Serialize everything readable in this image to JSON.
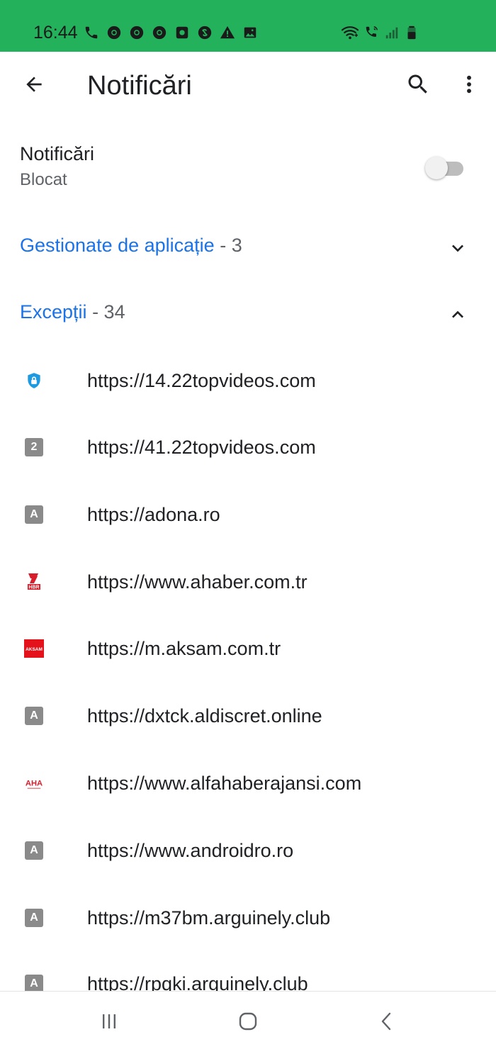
{
  "status_bar": {
    "time": "16:44",
    "background": "#23b25b",
    "left_icons": [
      "phone-icon",
      "chrome-icon",
      "chrome-icon",
      "chrome-icon",
      "screen-recorder-icon",
      "shazam-icon",
      "warning-icon",
      "image-icon"
    ],
    "right_icons": [
      "wifi-icon",
      "wifi-call-icon",
      "signal-icon",
      "battery-icon"
    ]
  },
  "app_bar": {
    "title": "Notificări",
    "back_icon": "arrow-back-icon",
    "search_icon": "search-icon",
    "more_icon": "more-vert-icon"
  },
  "notifications_setting": {
    "title": "Notificări",
    "subtitle": "Blocat",
    "enabled": false
  },
  "sections": {
    "managed": {
      "label": "Gestionate de aplicație",
      "count": "- 3",
      "expanded": false
    },
    "exceptions": {
      "label": "Excepții",
      "count": "- 34",
      "expanded": true
    }
  },
  "accent_color": "#1a73e8",
  "sites": [
    {
      "url": "https://14.22topvideos.com",
      "icon": "shield-lock-icon"
    },
    {
      "url": "https://41.22topvideos.com",
      "icon": "letter-badge",
      "letter": "2"
    },
    {
      "url": "https://adona.ro",
      "icon": "letter-badge",
      "letter": "A"
    },
    {
      "url": "https://www.ahaber.com.tr",
      "icon": "ahaber-favicon",
      "brand_text": "HBR"
    },
    {
      "url": "https://m.aksam.com.tr",
      "icon": "aksam-favicon",
      "brand_text": "AKSAM"
    },
    {
      "url": "https://dxtck.aldiscret.online",
      "icon": "letter-badge",
      "letter": "A"
    },
    {
      "url": "https://www.alfahaberajansi.com",
      "icon": "aha-favicon",
      "brand_text": "AHA"
    },
    {
      "url": "https://www.androidro.ro",
      "icon": "letter-badge",
      "letter": "A"
    },
    {
      "url": "https://m37bm.arguinely.club",
      "icon": "letter-badge",
      "letter": "A"
    },
    {
      "url": "https://rpqki.arguinely.club",
      "icon": "letter-badge",
      "letter": "A"
    }
  ],
  "nav_bar": {
    "recents_icon": "recents-icon",
    "home_icon": "home-icon",
    "back_icon": "nav-back-icon"
  }
}
